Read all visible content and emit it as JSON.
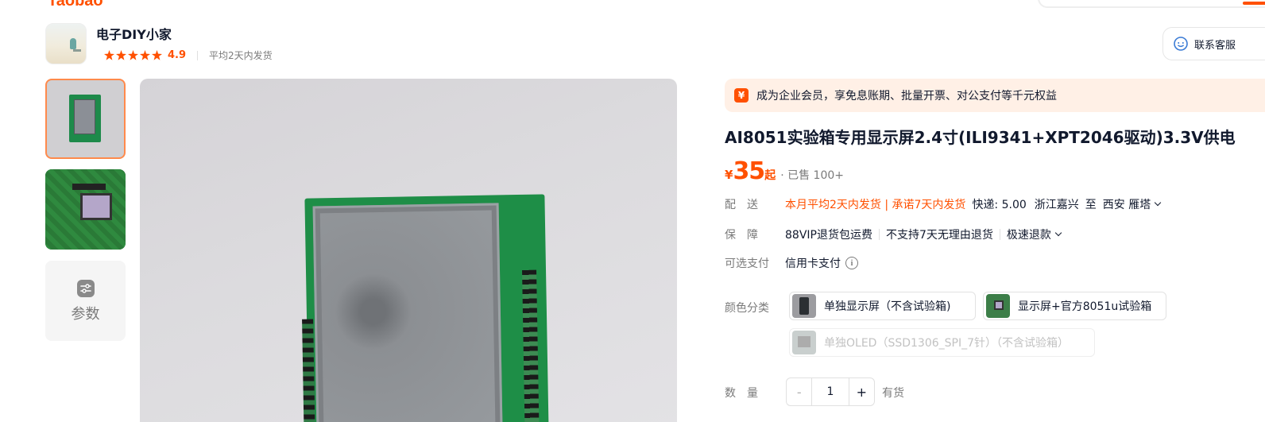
{
  "brand": {
    "logo_text": "Taobao"
  },
  "shop": {
    "name": "电子DIY小家",
    "rating_score": "4.9",
    "stars": 5,
    "avg_shipping": "平均2天内发货"
  },
  "service": {
    "label": "联系客服"
  },
  "gallery": {
    "thumbnails": [
      "display-board",
      "experiment-box"
    ],
    "params_label": "参数"
  },
  "vip_banner": {
    "icon_text": "¥",
    "text": "成为企业会员，享免息账期、批量开票、对公支付等千元权益"
  },
  "product": {
    "title": "AI8051实验箱专用显示屏2.4寸(ILI9341+XPT2046驱动)3.3V供电",
    "price_currency": "¥",
    "price_value": "35",
    "price_suffix": "起",
    "sold": "· 已售 100+"
  },
  "delivery": {
    "label": "配　送",
    "promise": "本月平均2天内发货 | 承诺7天内发货",
    "express": "快递: 5.00",
    "from": "浙江嘉兴",
    "to_word": "至",
    "to": "西安 雁塔"
  },
  "guarantee": {
    "label": "保　障",
    "items": [
      "88VIP退货包运费",
      "不支持7天无理由退货",
      "极速退款"
    ]
  },
  "payment": {
    "label": "可选支付",
    "method": "信用卡支付",
    "info_icon": "i"
  },
  "color_options": {
    "label": "颜色分类",
    "options": [
      {
        "label": "单独显示屏（不含试验箱)",
        "disabled": false
      },
      {
        "label": "显示屏+官方8051u试验箱",
        "disabled": false
      },
      {
        "label": "单独OLED（SSD1306_SPI_7针）（不含试验箱）",
        "disabled": true
      }
    ]
  },
  "quantity": {
    "label": "数　量",
    "minus": "-",
    "value": "1",
    "plus": "+",
    "stock": "有货"
  },
  "colors": {
    "accent": "#ff5000",
    "text": "#11192d",
    "muted": "#7a7a7a",
    "banner_bg": "#fff0e6"
  }
}
